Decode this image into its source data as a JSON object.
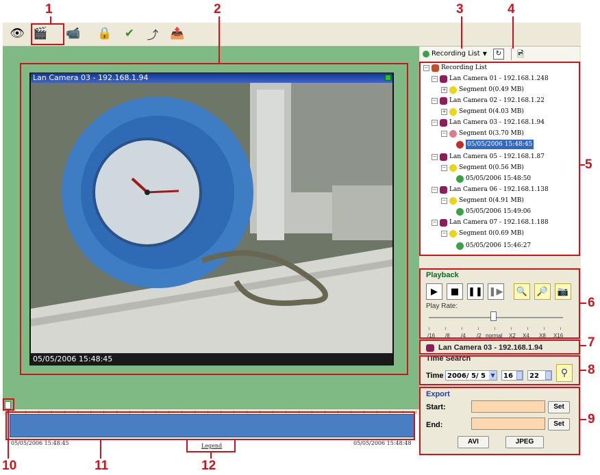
{
  "callouts": [
    "1",
    "2",
    "3",
    "4",
    "5",
    "6",
    "7",
    "8",
    "9",
    "10",
    "11",
    "12"
  ],
  "toolbar": {
    "icons": [
      "eye-icon",
      "camera-icon",
      "camera-group-icon",
      "lock-icon",
      "check-icon",
      "arrow-icon",
      "export-icon"
    ]
  },
  "video": {
    "title": "Lan Camera 03 - 192.168.1.94",
    "timestamp": "05/05/2006 15:48:45"
  },
  "recording": {
    "dropdown_label": "Recording List",
    "tree": {
      "root": "Recording List",
      "cameras": [
        {
          "name": "Lan Camera 01 - 192.168.1.248",
          "segment": "Segment 0(0.49 MB)",
          "clip": ""
        },
        {
          "name": "Lan Camera 02 - 192.168.1.22",
          "segment": "Segment 0(4.03 MB)",
          "clip": ""
        },
        {
          "name": "Lan Camera 03 - 192.168.1.94",
          "segment": "Segment 0(3.70 MB)",
          "clip": "05/05/2006 15:48:45"
        },
        {
          "name": "Lan Camera 05 - 192.168.1.87",
          "segment": "Segment 0(0.56 MB)",
          "clip": "05/05/2006 15:48:50"
        },
        {
          "name": "Lan Camera 06 - 192.168.1.138",
          "segment": "Segment 0(4.91 MB)",
          "clip": "05/05/2006 15:49:06"
        },
        {
          "name": "Lan Camera 07 - 192.168.1.188",
          "segment": "Segment 0(0.69 MB)",
          "clip": "05/05/2006 15:46:27"
        }
      ]
    }
  },
  "playback": {
    "title": "Playback",
    "play_rate_label": "Play Rate:",
    "rate_ticks": [
      "/16",
      "/8",
      "/4",
      "/2",
      "normal",
      "X2",
      "X4",
      "X8",
      "X16"
    ],
    "rate_value": "normal"
  },
  "camera_label": "Lan Camera 03 - 192.168.1.94",
  "time_search": {
    "title": "Time Search",
    "time_label": "Time",
    "date": "2006/ 5/ 5",
    "hour": "16",
    "minute": "22"
  },
  "export": {
    "title": "Export",
    "start_label": "Start:",
    "end_label": "End:",
    "set_label": "Set",
    "avi_label": "AVI",
    "jpeg_label": "JPEG"
  },
  "timeline": {
    "start_time": "05/05/2006 15:48:45",
    "end_time": "05/05/2006 15:48:48",
    "legend_label": "Legend"
  },
  "colors": {
    "callout": "#d0121c",
    "main_bg": "#7fba84",
    "timeline": "#4a7ec2",
    "selection": "#316ac5"
  }
}
